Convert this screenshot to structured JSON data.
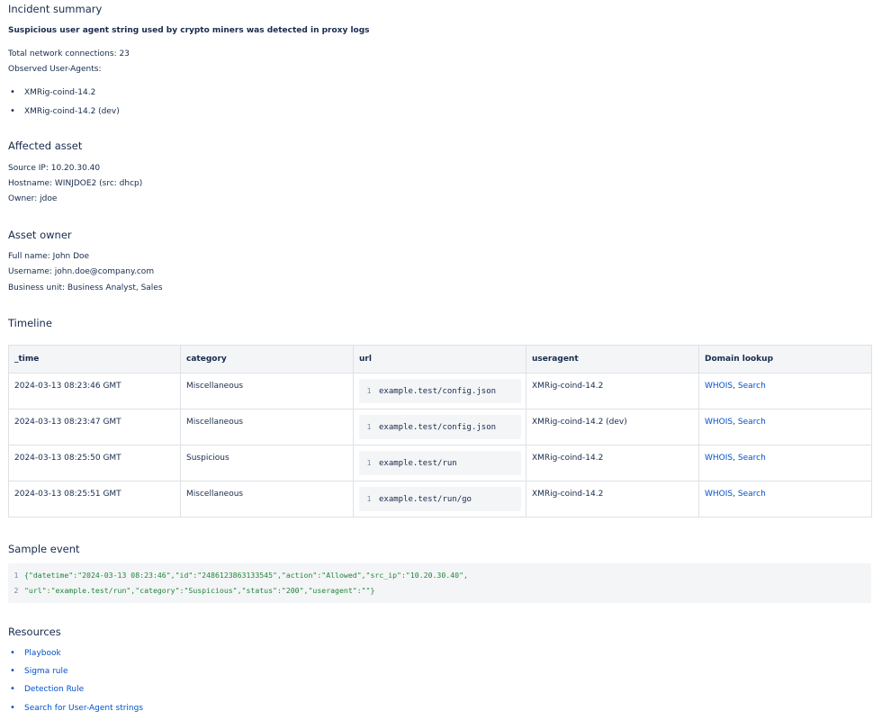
{
  "incident": {
    "heading": "Incident summary",
    "title": "Suspicious user agent string used by crypto miners was detected in proxy logs",
    "connections": "Total network connections: 23",
    "observed_label": "Observed User-Agents:",
    "user_agents": [
      "XMRig-coind-14.2",
      "XMRig-coind-14.2 (dev)"
    ]
  },
  "affected_asset": {
    "heading": "Affected asset",
    "source_ip": "Source IP: 10.20.30.40",
    "hostname": "Hostname: WINJDOE2 (src: dhcp)",
    "owner": "Owner: jdoe"
  },
  "asset_owner": {
    "heading": "Asset owner",
    "full_name": "Full name: John Doe",
    "username": "Username: john.doe@company.com",
    "business_unit": "Business unit: Business Analyst, Sales"
  },
  "timeline": {
    "heading": "Timeline",
    "columns": [
      "_time",
      "category",
      "url",
      "useragent",
      "Domain lookup"
    ],
    "rows": [
      {
        "time": "2024-03-13 08:23:46 GMT",
        "category": "Miscellaneous",
        "url_line": "1",
        "url": "example.test/config.json",
        "useragent": "XMRig-coind-14.2",
        "whois": "WHOIS",
        "sep": ", ",
        "search": "Search"
      },
      {
        "time": "2024-03-13 08:23:47 GMT",
        "category": "Miscellaneous",
        "url_line": "1",
        "url": "example.test/config.json",
        "useragent": "XMRig-coind-14.2 (dev)",
        "whois": "WHOIS",
        "sep": ", ",
        "search": "Search"
      },
      {
        "time": "2024-03-13 08:25:50 GMT",
        "category": "Suspicious",
        "url_line": "1",
        "url": "example.test/run",
        "useragent": "XMRig-coind-14.2",
        "whois": "WHOIS",
        "sep": ", ",
        "search": "Search"
      },
      {
        "time": "2024-03-13 08:25:51 GMT",
        "category": "Miscellaneous",
        "url_line": "1",
        "url": "example.test/run/go",
        "useragent": "XMRig-coind-14.2",
        "whois": "WHOIS",
        "sep": ", ",
        "search": "Search"
      }
    ]
  },
  "sample_event": {
    "heading": "Sample event",
    "lines": [
      {
        "n": "1",
        "text": "{\"datetime\":\"2024-03-13 08:23:46\",\"id\":\"2486123863133545\",\"action\":\"Allowed\",\"src_ip\":\"10.20.30.40\","
      },
      {
        "n": "2",
        "text": "\"url\":\"example.test/run\",\"category\":\"Suspicious\",\"status\":\"200\",\"useragent\":\"\"}"
      }
    ]
  },
  "resources": {
    "heading": "Resources",
    "links": [
      "Playbook",
      "Sigma rule",
      "Detection Rule",
      "Search for User-Agent strings"
    ]
  },
  "colors": {
    "link": "#0052cc",
    "text": "#172b4d",
    "code_string": "#22863a",
    "table_header_bg": "#f4f5f7"
  }
}
